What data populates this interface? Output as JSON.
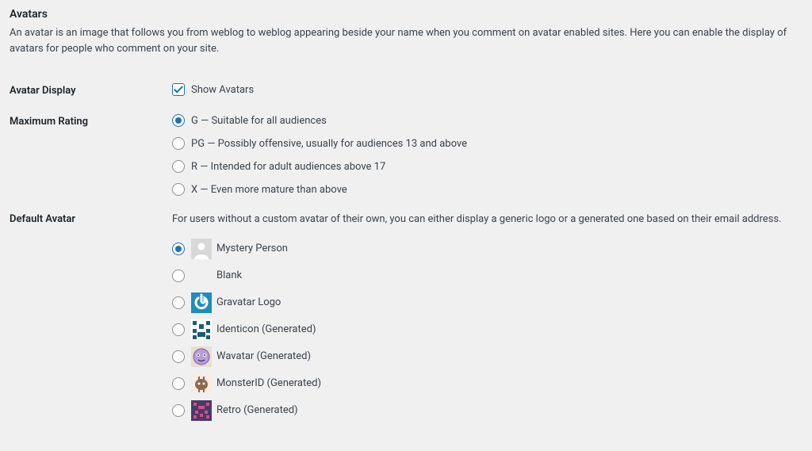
{
  "section": {
    "title": "Avatars",
    "description": "An avatar is an image that follows you from weblog to weblog appearing beside your name when you comment on avatar enabled sites. Here you can enable the display of avatars for people who comment on your site."
  },
  "avatar_display": {
    "heading": "Avatar Display",
    "checkbox_label": "Show Avatars",
    "checked": true
  },
  "maximum_rating": {
    "heading": "Maximum Rating",
    "selected": "G",
    "options": [
      {
        "value": "G",
        "label": "G — Suitable for all audiences"
      },
      {
        "value": "PG",
        "label": "PG — Possibly offensive, usually for audiences 13 and above"
      },
      {
        "value": "R",
        "label": "R — Intended for adult audiences above 17"
      },
      {
        "value": "X",
        "label": "X — Even more mature than above"
      }
    ]
  },
  "default_avatar": {
    "heading": "Default Avatar",
    "intro": "For users without a custom avatar of their own, you can either display a generic logo or a generated one based on their email address.",
    "selected": "mystery",
    "options": [
      {
        "value": "mystery",
        "label": "Mystery Person"
      },
      {
        "value": "blank",
        "label": "Blank"
      },
      {
        "value": "gravatar",
        "label": "Gravatar Logo"
      },
      {
        "value": "identicon",
        "label": "Identicon (Generated)"
      },
      {
        "value": "wavatar",
        "label": "Wavatar (Generated)"
      },
      {
        "value": "monsterid",
        "label": "MonsterID (Generated)"
      },
      {
        "value": "retro",
        "label": "Retro (Generated)"
      }
    ]
  }
}
